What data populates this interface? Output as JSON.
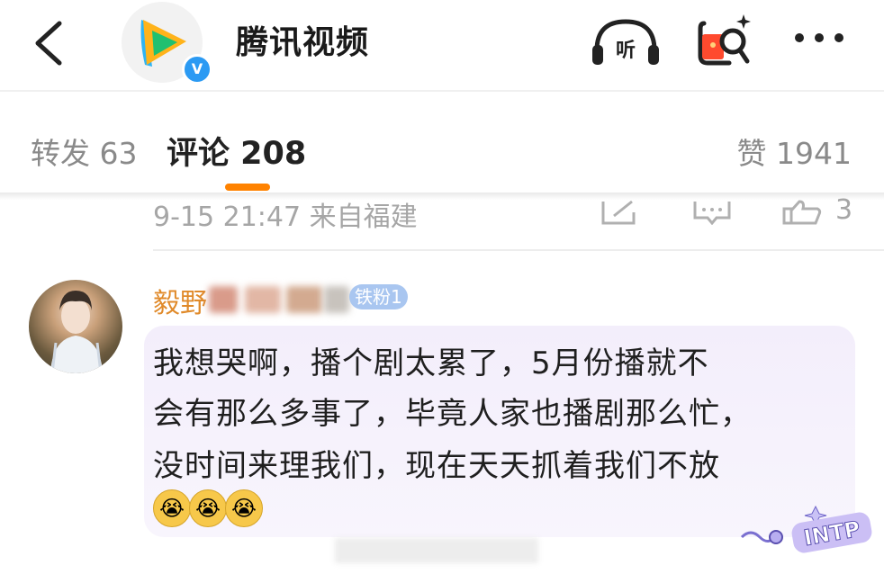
{
  "header": {
    "title": "腾讯视频",
    "verified_badge": "V",
    "listen_label": "听"
  },
  "tabs": {
    "repost": "转发 63",
    "comment": "评论 208",
    "like": "赞 1941"
  },
  "prev_comment_meta": {
    "time_location": "9-15 21:47  来自福建",
    "like_count": "3"
  },
  "comment": {
    "username_visible": "毅野",
    "fans_badge": "铁粉1",
    "lines": [
      "我想哭啊，播个剧太累了，5月份播就不",
      "会有那么多事了，毕竟人家也播剧那么忙，",
      "没时间来理我们，现在天天抓着我们不放"
    ],
    "emoji_glyph": "😭"
  },
  "watermark": {
    "text": "INTP"
  },
  "colors": {
    "accent_orange": "#ff8200",
    "username_orange": "#e08a2a",
    "bubble_lilac": "#f3eefb",
    "muted_gray": "#a6a6a6"
  }
}
